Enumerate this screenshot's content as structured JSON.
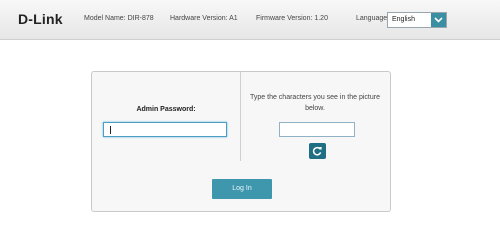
{
  "header": {
    "logo": "D-Link",
    "model": "Model Name: DIR-878",
    "hardware": "Hardware Version: A1",
    "firmware": "Firmware Version: 1.20",
    "language_label": "Language:",
    "language_value": "English"
  },
  "login": {
    "password_label": "Admin Password:",
    "password_value": "",
    "captcha_instructions": "Type the characters you see in the picture below.",
    "captcha_value": "",
    "login_button": "Log In"
  },
  "colors": {
    "accent": "#3f97ad",
    "refresh": "#1f6e84",
    "focus_border": "#4c9fc2"
  },
  "icons": {
    "language_dropdown": "chevron-down-icon",
    "refresh": "refresh-icon"
  }
}
